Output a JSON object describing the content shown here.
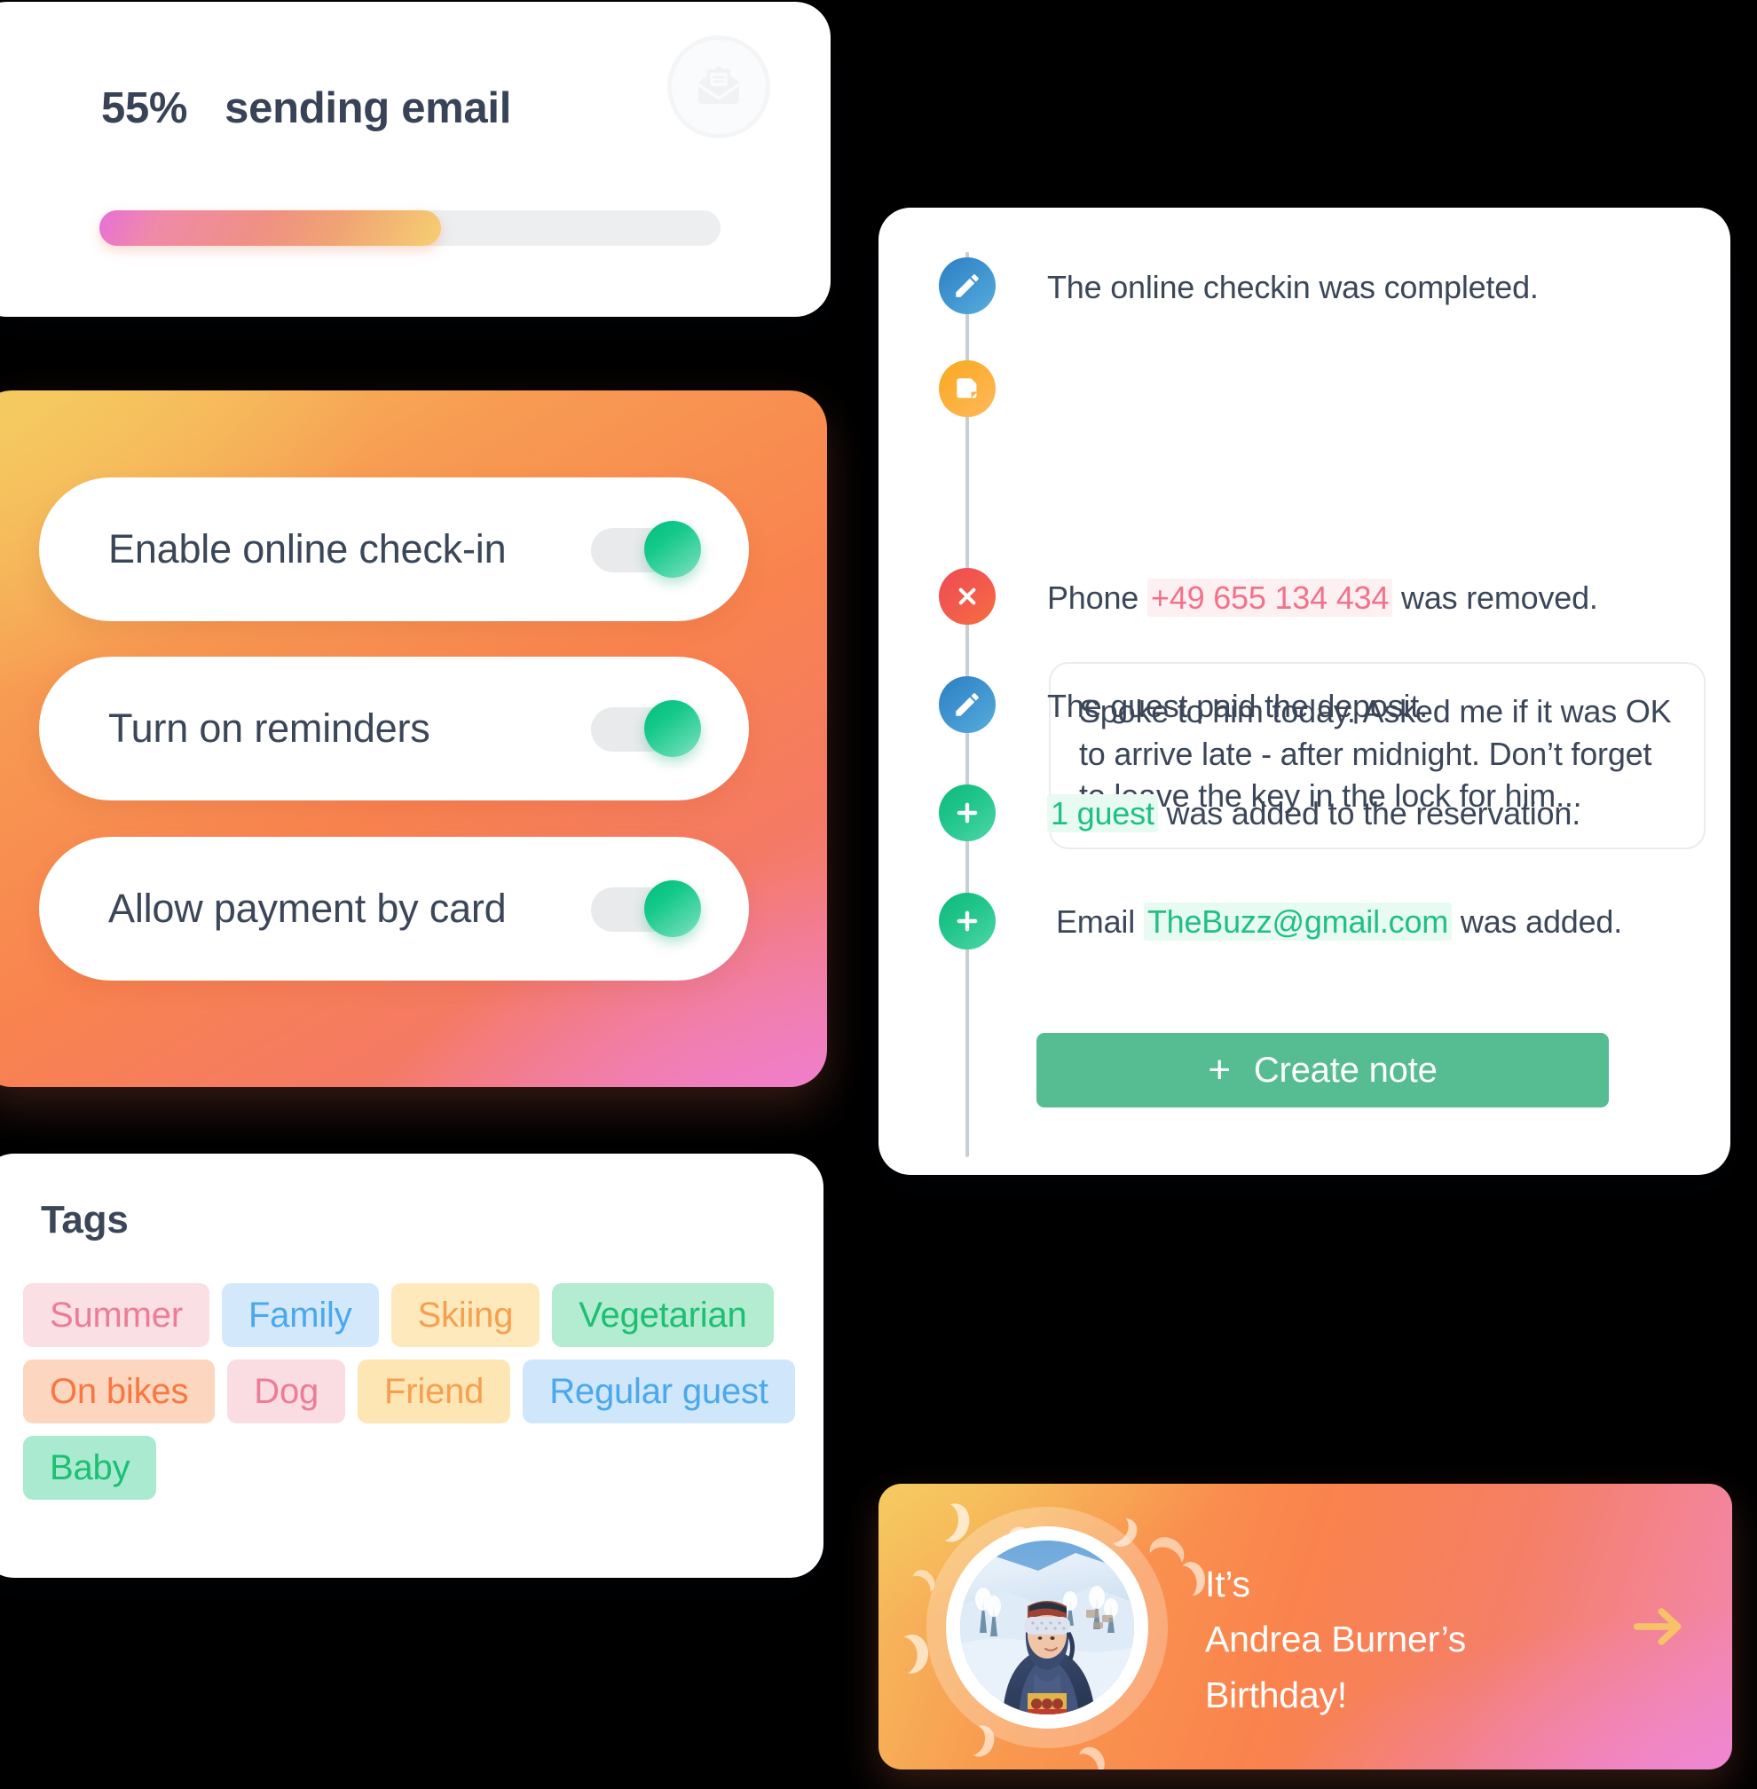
{
  "progress": {
    "percent_label": "55%",
    "status_label": "sending email",
    "percent_value": 55,
    "icon": "mail-document-icon",
    "fill_gradient": [
      "#e86fd8",
      "#ef9183",
      "#f6cf72"
    ],
    "track_color": "#eceef0"
  },
  "settings": {
    "toggles": [
      {
        "label": "Enable online check-in",
        "on": true
      },
      {
        "label": "Turn on reminders",
        "on": true
      },
      {
        "label": "Allow payment by card",
        "on": true
      }
    ],
    "knob_color": "#14c98a",
    "track_color": "#e8eaec"
  },
  "tags": {
    "title": "Tags",
    "items": [
      {
        "label": "Summer",
        "bg": "#fadfe4",
        "fg": "#ec7d96"
      },
      {
        "label": "Family",
        "bg": "#d3e9fb",
        "fg": "#4aa8ec"
      },
      {
        "label": "Skiing",
        "bg": "#fde9bb",
        "fg": "#f6a04f"
      },
      {
        "label": "Vegetarian",
        "bg": "#b4ecd1",
        "fg": "#1dbf73"
      },
      {
        "label": "On bikes",
        "bg": "#fdd6c0",
        "fg": "#f9773f"
      },
      {
        "label": "Dog",
        "bg": "#f9dde3",
        "fg": "#ec7d96"
      },
      {
        "label": "Friend",
        "bg": "#fde5b4",
        "fg": "#f6a04f"
      },
      {
        "label": "Regular guest",
        "bg": "#cfe6fb",
        "fg": "#4aa8ec"
      },
      {
        "label": "Baby",
        "bg": "#a9ead0",
        "fg": "#1dbf73"
      }
    ]
  },
  "timeline": {
    "events": [
      {
        "icon": "pencil-icon",
        "type": "pencil",
        "text": "The online checkin was completed."
      },
      {
        "icon": "note-icon",
        "type": "note",
        "note_text": "Spoke to him today. Asked me if it was OK to arrive late - after midnight.\nDon’t forget to leave the key in the lock for him..."
      },
      {
        "icon": "close-icon",
        "type": "cross",
        "prefix": "Phone",
        "highlight": "+49 655 134 434",
        "highlight_style": "red",
        "suffix": "was removed."
      },
      {
        "icon": "pencil-icon",
        "type": "pencil",
        "text": "The guest paid the deposit."
      },
      {
        "icon": "plus-icon",
        "type": "plus",
        "prefix": "",
        "highlight": "1 guest",
        "highlight_style": "green",
        "suffix": "was added to the reservation."
      },
      {
        "icon": "plus-icon",
        "type": "plus",
        "prefix": "Email",
        "highlight": "TheBuzz@gmail.com",
        "highlight_style": "green",
        "suffix": "was added."
      }
    ],
    "create_note_button": {
      "plus": "+",
      "label": "Create note",
      "color": "#55bd91"
    }
  },
  "birthday": {
    "message": "It’s\nAndrea Burner’s\nBirthday!",
    "person_name": "Andrea Burner",
    "avatar": "winter-mountain-portrait-photo",
    "arrow_icon": "arrow-right-icon",
    "arrow_color": "#f6c368"
  }
}
